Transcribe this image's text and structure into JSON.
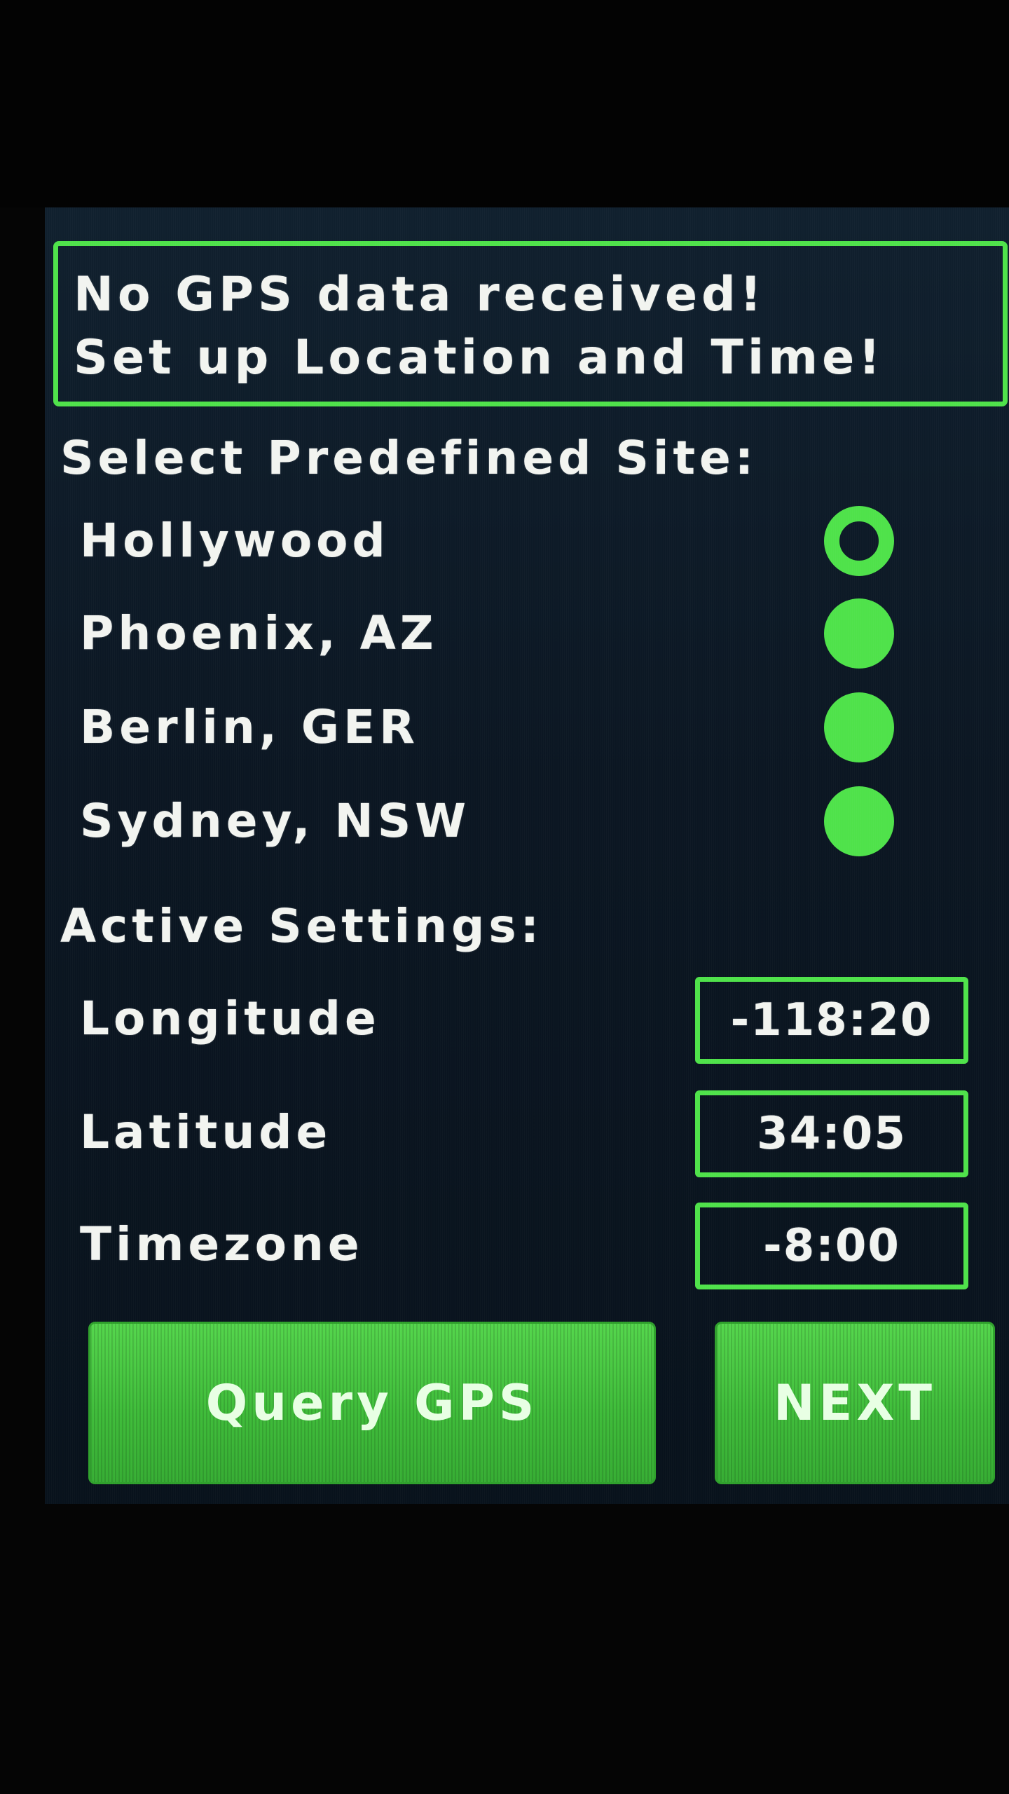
{
  "alert": {
    "line1": "No GPS data received!",
    "line2": "Set up Location and Time!"
  },
  "sites_section": {
    "title": "Select Predefined Site:",
    "items": [
      {
        "label": "Hollywood",
        "selected": true
      },
      {
        "label": "Phoenix, AZ",
        "selected": false
      },
      {
        "label": "Berlin, GER",
        "selected": false
      },
      {
        "label": "Sydney, NSW",
        "selected": false
      }
    ]
  },
  "settings_section": {
    "title": "Active Settings:",
    "longitude": {
      "label": "Longitude",
      "value": "-118:20"
    },
    "latitude": {
      "label": "Latitude",
      "value": "34:05"
    },
    "timezone": {
      "label": "Timezone",
      "value": "-8:00"
    }
  },
  "buttons": {
    "query_gps": "Query GPS",
    "next": "NEXT"
  },
  "colors": {
    "accent": "#4fe24a",
    "background": "#0b1622",
    "text": "#f2f4f0"
  }
}
